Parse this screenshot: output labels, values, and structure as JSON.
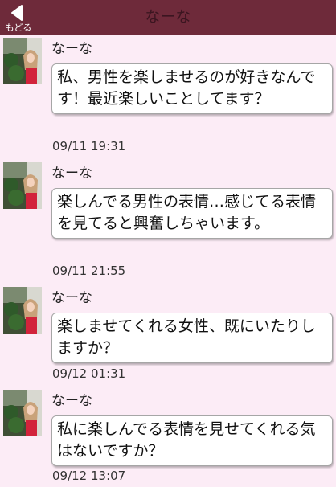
{
  "header": {
    "title": "なーな",
    "back_label": "もどる",
    "background_color": "#6e2a3a"
  },
  "messages": [
    {
      "sender": "なーな",
      "text": "私、男性を楽しませるのが好きなんです！最近楽しいことしてます？",
      "time": "09/11 19:31"
    },
    {
      "sender": "なーな",
      "text": "楽しんでる男性の表情…感じてる表情を見てると興奮しちゃいます。",
      "time": "09/11 21:55"
    },
    {
      "sender": "なーな",
      "text": "楽しませてくれる女性、既にいたりしますか？",
      "time": "09/12 01:31"
    },
    {
      "sender": "なーな",
      "text": "私に楽しんでる表情を見せてくれる気はないですか？",
      "time": "09/12 13:07"
    }
  ]
}
